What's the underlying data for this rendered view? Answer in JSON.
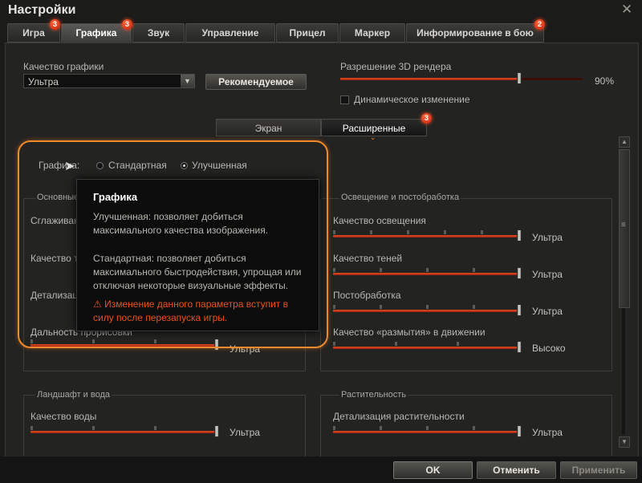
{
  "window": {
    "title": "Настройки",
    "close_glyph": "✕"
  },
  "tabs": [
    {
      "label": "Игра",
      "badge": "3"
    },
    {
      "label": "Графика",
      "badge": "3"
    },
    {
      "label": "Звук",
      "badge": ""
    },
    {
      "label": "Управление",
      "badge": ""
    },
    {
      "label": "Прицел",
      "badge": ""
    },
    {
      "label": "Маркер",
      "badge": ""
    },
    {
      "label": "Информирование в бою",
      "badge": "2"
    }
  ],
  "quality": {
    "label": "Качество графики",
    "value": "Ультра",
    "recommended_button": "Рекомендуемое"
  },
  "render": {
    "label": "Разрешение 3D рендера",
    "value": 0.9,
    "value_text": "90%",
    "dynamic_label": "Динамическое изменение"
  },
  "subtabs": [
    {
      "label": "Экран"
    },
    {
      "label": "Расширенные",
      "badge": "3"
    }
  ],
  "graphics_mode": {
    "label": "Графика:",
    "options": [
      "Стандартная",
      "Улучшенная"
    ],
    "selected": "Улучшенная"
  },
  "group_basic": {
    "title": "Основные",
    "rows": [
      {
        "label": "Сглаживание",
        "value": ""
      },
      {
        "label": "Качество текстур",
        "value": ""
      },
      {
        "label": "Детализация объектов",
        "value": ""
      },
      {
        "label": "Дальность прорисовки",
        "value": "Ультра"
      }
    ]
  },
  "group_light": {
    "title": "Освещение и постобработка",
    "rows": [
      {
        "label": "Качество освещения",
        "value": "Ультра"
      },
      {
        "label": "Качество теней",
        "value": "Ультра"
      },
      {
        "label": "Постобработка",
        "value": "Ультра"
      },
      {
        "label": "Качество «размытия» в движении",
        "value": "Высоко"
      }
    ]
  },
  "group_land": {
    "title": "Ландшафт и вода",
    "rows": [
      {
        "label": "Качество воды",
        "value": "Ультра"
      }
    ]
  },
  "group_veg": {
    "title": "Растительность",
    "rows": [
      {
        "label": "Детализация растительности",
        "value": "Ультра"
      }
    ]
  },
  "tooltip": {
    "title": "Графика",
    "p1": "Улучшенная: позволяет добиться максимального качества изображения.",
    "p2": "Стандартная: позволяет добиться максимального быстродействия, упрощая или отключая некоторые визуальные эффекты.",
    "warning": "Изменение данного параметра вступит в силу после перезапуска игры.",
    "warning_icon": "⚠"
  },
  "footer": {
    "ok": "OK",
    "cancel": "Отменить",
    "apply": "Применить"
  },
  "colors": {
    "accent": "#f08a2a",
    "slider_fill": "#e84c22",
    "badge": "#d8260f"
  },
  "icons": {
    "dropdown": "▼",
    "scroll_up": "▲",
    "scroll_down": "▼",
    "grip": "≡"
  }
}
